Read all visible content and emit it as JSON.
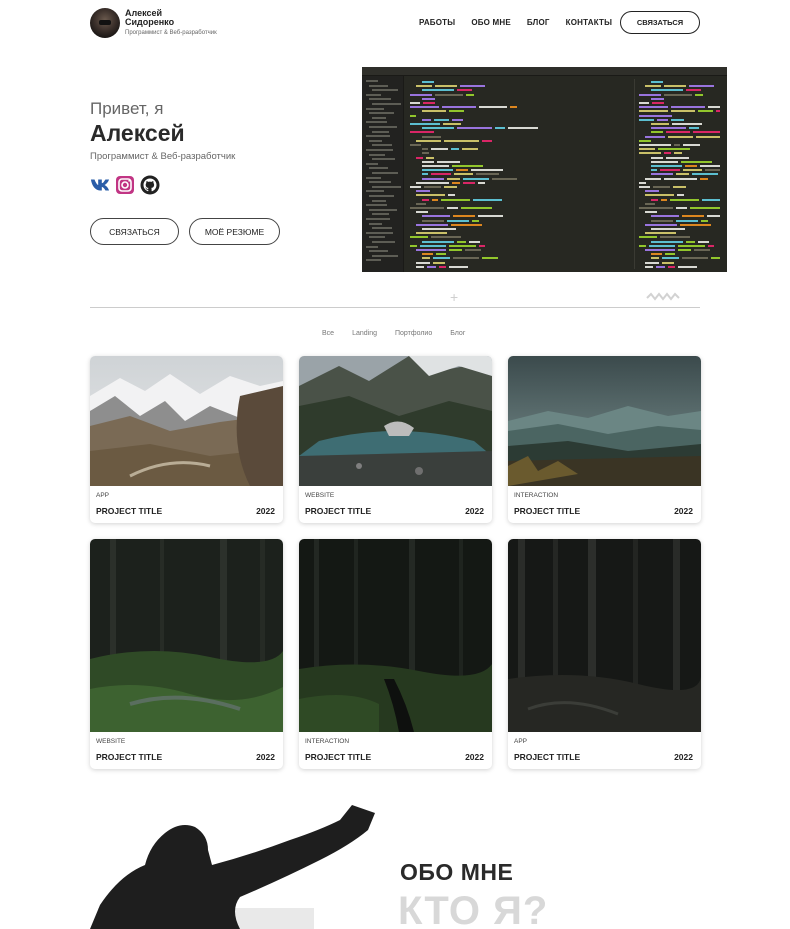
{
  "header": {
    "name": "Алексей Сидоренко",
    "subtitle": "Программист & Веб-разработчик",
    "nav": [
      "РАБОТЫ",
      "ОБО МНЕ",
      "БЛОГ",
      "КОНТАКТЫ"
    ],
    "cta": "СВЯЗАТЬСЯ"
  },
  "hero": {
    "greeting": "Привет, я",
    "name": "Алексей",
    "role": "Программист & Веб-разработчик",
    "socials": [
      "vk-icon",
      "instagram-icon",
      "github-icon"
    ],
    "btn_contact": "СВЯЗАТЬСЯ",
    "btn_resume": "МОЁ РЕЗЮМЕ"
  },
  "filters": [
    "Все",
    "Landing",
    "Портфолио",
    "Блог"
  ],
  "projects": [
    {
      "category": "APP",
      "title": "PROJECT TITLE",
      "year": "2022"
    },
    {
      "category": "WEBSITE",
      "title": "PROJECT TITLE",
      "year": "2022"
    },
    {
      "category": "INTERACTION",
      "title": "PROJECT TITLE",
      "year": "2022"
    },
    {
      "category": "WEBSITE",
      "title": "PROJECT TITLE",
      "year": "2022"
    },
    {
      "category": "INTERACTION",
      "title": "PROJECT TITLE",
      "year": "2022"
    },
    {
      "category": "APP",
      "title": "PROJECT TITLE",
      "year": "2022"
    }
  ],
  "about": {
    "title": "ОБО МНЕ",
    "subtitle": "КТО Я?"
  },
  "colors": {
    "text": "#222222",
    "muted": "#666666",
    "editor_bg": "#272822",
    "instagram": "#c13584"
  }
}
